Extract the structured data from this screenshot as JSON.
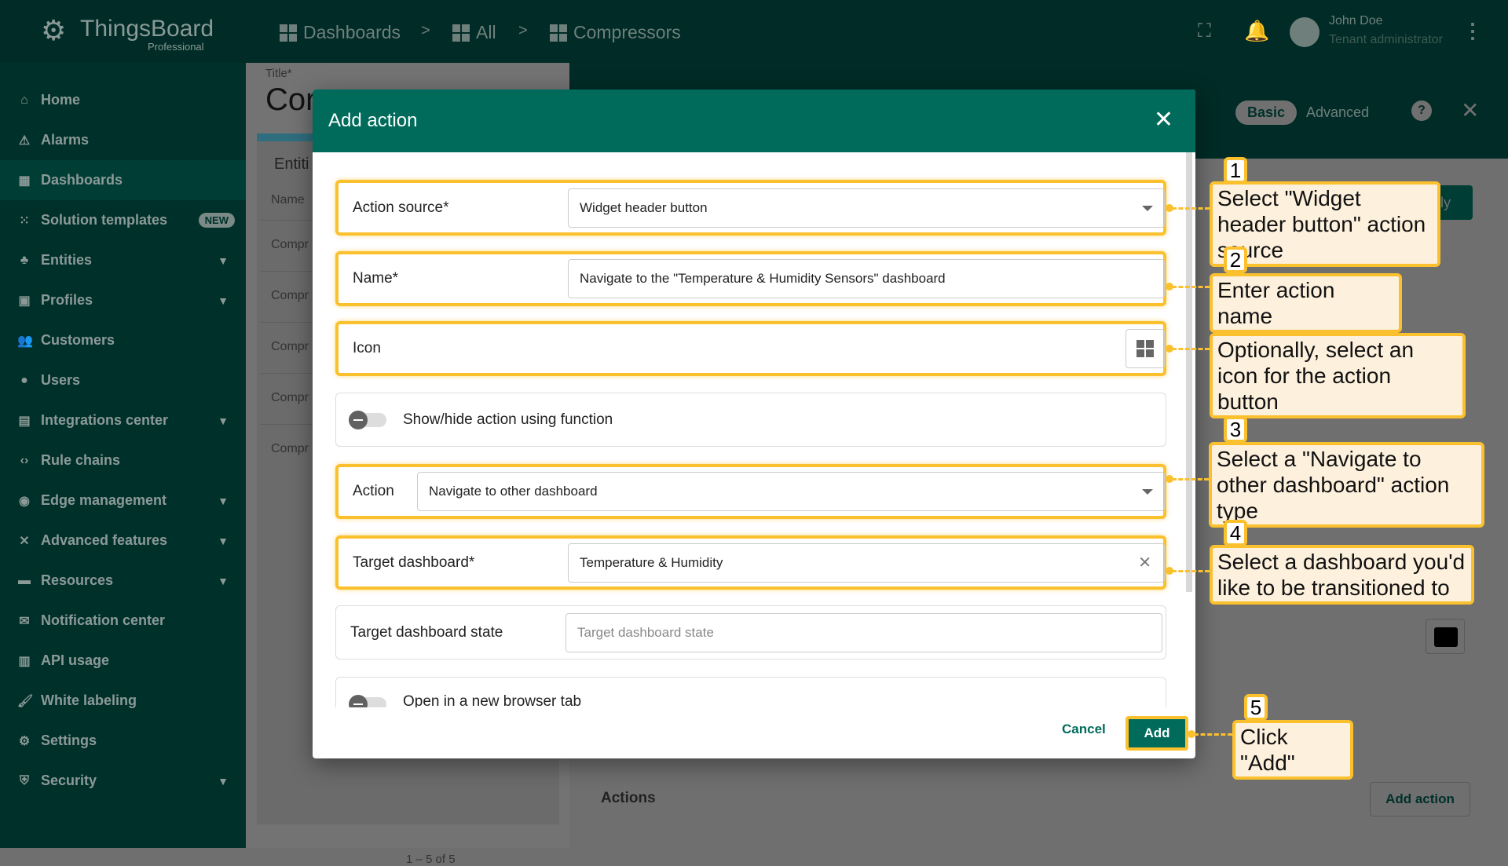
{
  "app": {
    "logo": "ThingsBoard",
    "edition": "Professional"
  },
  "breadcrumb": [
    "Dashboards",
    "All",
    "Compressors"
  ],
  "user": {
    "name": "John Doe",
    "role": "Tenant administrator"
  },
  "sidebar": {
    "items": [
      {
        "label": "Home",
        "icon": "⌂"
      },
      {
        "label": "Alarms",
        "icon": "⚠"
      },
      {
        "label": "Dashboards",
        "icon": "▦",
        "active": true
      },
      {
        "label": "Solution templates",
        "icon": "⁙",
        "badge": "NEW"
      },
      {
        "label": "Entities",
        "icon": "♣",
        "chev": true
      },
      {
        "label": "Profiles",
        "icon": "▣",
        "chev": true
      },
      {
        "label": "Customers",
        "icon": "👥"
      },
      {
        "label": "Users",
        "icon": "●"
      },
      {
        "label": "Integrations center",
        "icon": "▤",
        "chev": true
      },
      {
        "label": "Rule chains",
        "icon": "‹›"
      },
      {
        "label": "Edge management",
        "icon": "◉",
        "chev": true
      },
      {
        "label": "Advanced features",
        "icon": "✕",
        "chev": true
      },
      {
        "label": "Resources",
        "icon": "▬",
        "chev": true
      },
      {
        "label": "Notification center",
        "icon": "✉"
      },
      {
        "label": "API usage",
        "icon": "▥"
      },
      {
        "label": "White labeling",
        "icon": "🖌"
      },
      {
        "label": "Settings",
        "icon": "⚙"
      },
      {
        "label": "Security",
        "icon": "⛨",
        "chev": true
      }
    ]
  },
  "background": {
    "title_label": "Title*",
    "title_value": "Cor",
    "entities": "Entiti",
    "name_col": "Name",
    "rows": [
      "Compr",
      "Compr",
      "Compr",
      "Compr",
      "Compr"
    ],
    "pagination": "1 – 5 of 5",
    "mode_basic": "Basic",
    "mode_advanced": "Advanced",
    "apply": "pply",
    "actions_heading": "Actions",
    "add_action": "Add action"
  },
  "dialog": {
    "title": "Add action",
    "action_source": {
      "label": "Action source*",
      "value": "Widget header button"
    },
    "name": {
      "label": "Name*",
      "value": "Navigate to the \"Temperature & Humidity Sensors\" dashboard"
    },
    "icon": {
      "label": "Icon"
    },
    "show_hide": {
      "label": "Show/hide action using function"
    },
    "action": {
      "label": "Action",
      "value": "Navigate to other dashboard"
    },
    "target_dashboard": {
      "label": "Target dashboard*",
      "value": "Temperature & Humidity"
    },
    "target_state": {
      "label": "Target dashboard state",
      "placeholder": "Target dashboard state"
    },
    "new_tab": {
      "label": "Open in a new browser tab"
    },
    "cancel": "Cancel",
    "add": "Add"
  },
  "callouts": [
    {
      "num": "1",
      "text": "Select \"Widget header button\" action source"
    },
    {
      "num": "2",
      "text": "Enter action name"
    },
    {
      "num": "",
      "text": "Optionally, select an icon for the action button"
    },
    {
      "num": "3",
      "text": "Select a \"Navigate to other dashboard\" action type"
    },
    {
      "num": "4",
      "text": "Select a dashboard you'd like to be transitioned to"
    },
    {
      "num": "5",
      "text": "Click \"Add\""
    }
  ],
  "colors": {
    "primary": "#006b5b",
    "highlight": "#fbc02d",
    "callout_bg": "#fdf0dc"
  }
}
